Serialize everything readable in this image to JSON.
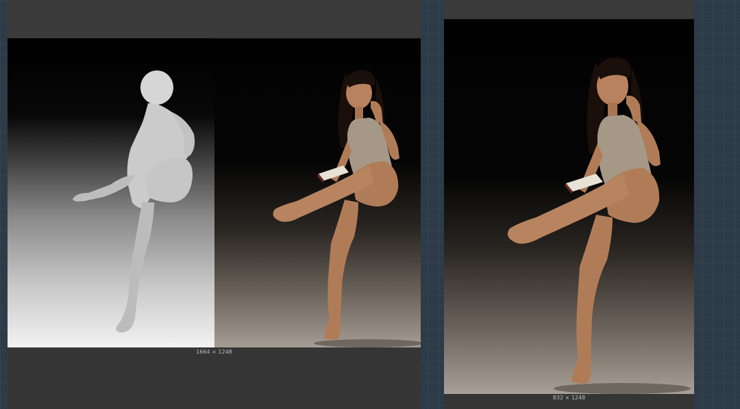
{
  "canvas": {
    "background_color": "#2d3b48"
  },
  "left_node": {
    "panels": [
      {
        "name": "depth-map",
        "icon": "depth-map-image"
      },
      {
        "name": "photo",
        "icon": "photo-image"
      }
    ],
    "dimensions": "1664 × 1248"
  },
  "right_node": {
    "icon": "photo-image",
    "dimensions": "832 × 1248"
  }
}
